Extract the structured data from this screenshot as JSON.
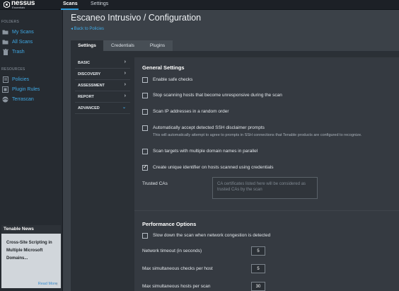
{
  "topbar": {
    "logo_word": "nessus",
    "logo_sub": "Essentials",
    "nav": [
      "Scans",
      "Settings"
    ]
  },
  "sidebar": {
    "folders_heading": "FOLDERS",
    "folders": [
      {
        "label": "My Scans",
        "icon": "folder-icon"
      },
      {
        "label": "All Scans",
        "icon": "folder-icon"
      },
      {
        "label": "Trash",
        "icon": "trash-icon"
      }
    ],
    "resources_heading": "RESOURCES",
    "resources": [
      {
        "label": "Policies",
        "icon": "policy-icon"
      },
      {
        "label": "Plugin Rules",
        "icon": "plugin-rules-icon"
      },
      {
        "label": "Terrascan",
        "icon": "terrascan-icon"
      }
    ],
    "news": {
      "heading": "Tenable News",
      "title": "Cross-Site Scripting in Multiple Microsoft Domains...",
      "read_more": "Read More"
    },
    "collapse_icon": "«"
  },
  "header": {
    "title": "Escaneo Intrusivo / Configuration",
    "back": "◂ Back to Policies"
  },
  "tabs": [
    "Settings",
    "Credentials",
    "Plugins"
  ],
  "categories": [
    {
      "label": "BASIC",
      "chevron": "›"
    },
    {
      "label": "DISCOVERY",
      "chevron": "›"
    },
    {
      "label": "ASSESSMENT",
      "chevron": "›"
    },
    {
      "label": "REPORT",
      "chevron": "›"
    },
    {
      "label": "ADVANCED",
      "chevron": "⌄"
    }
  ],
  "general": {
    "title": "General Settings",
    "options": [
      {
        "label": "Enable safe checks",
        "checked": false
      },
      {
        "label": "Stop scanning hosts that become unresponsive during the scan",
        "checked": false
      },
      {
        "label": "Scan IP addresses in a random order",
        "checked": false
      },
      {
        "label": "Automatically accept detected SSH disclaimer prompts",
        "sub": "This will automatically attempt to agree to prompts in SSH connections that Tenable products are configured to recognize.",
        "checked": false
      },
      {
        "label": "Scan targets with multiple domain names in parallel",
        "checked": false
      },
      {
        "label": "Create unique identifier on hosts scanned using credentials",
        "checked": true
      }
    ],
    "trusted_cas_label": "Trusted CAs",
    "trusted_cas_placeholder": "CA certificates listed here will be considered as trusted CAs by the scan"
  },
  "performance": {
    "title": "Performance Options",
    "slowdown": {
      "label": "Slow down the scan when network congestion is detected",
      "checked": false
    },
    "fields": [
      {
        "label": "Network timeout (in seconds)",
        "value": "5"
      },
      {
        "label": "Max simultaneous checks per host",
        "value": "5"
      },
      {
        "label": "Max simultaneous hosts per scan",
        "value": "30"
      }
    ]
  }
}
